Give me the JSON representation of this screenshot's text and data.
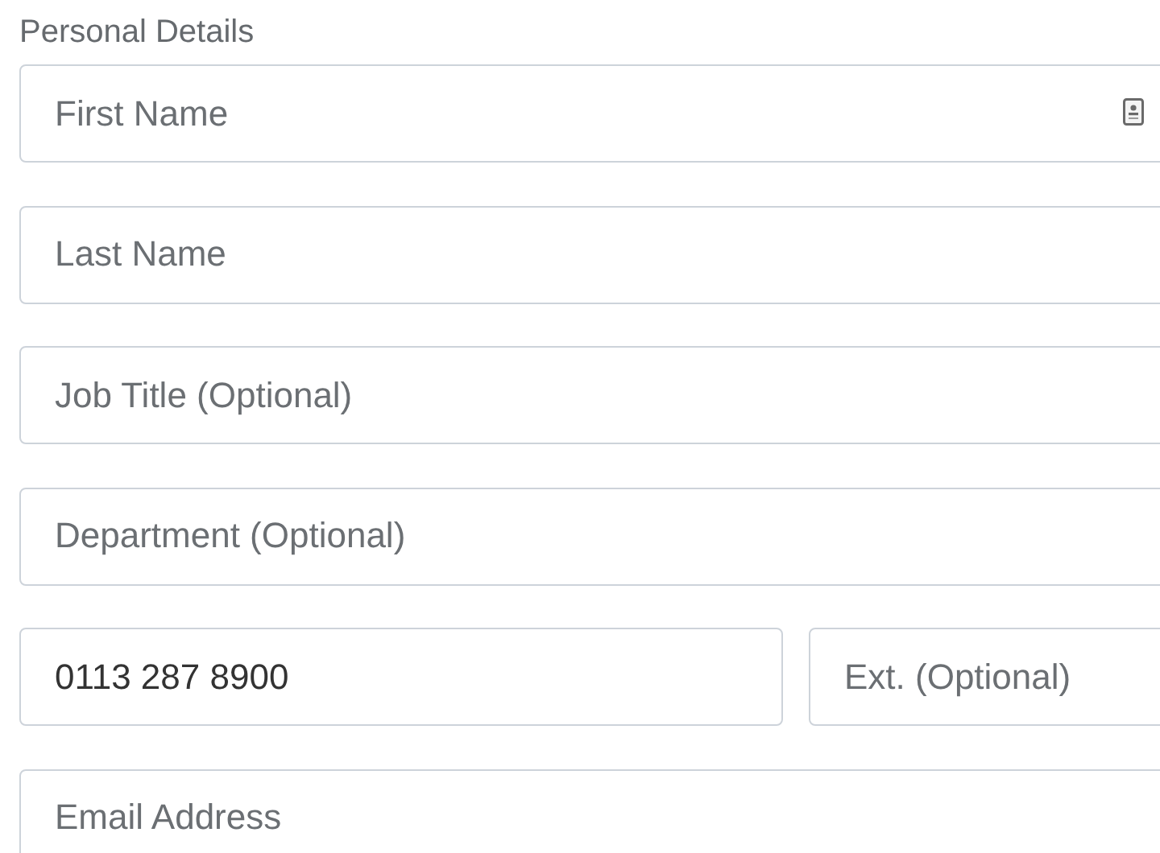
{
  "section_title": "Personal Details",
  "fields": [
    {
      "kind": "single",
      "inputs": [
        {
          "placeholder": "First Name",
          "autofill_icon": true
        }
      ]
    },
    {
      "kind": "single",
      "inputs": [
        {
          "placeholder": "Last Name"
        }
      ]
    },
    {
      "kind": "single",
      "inputs": [
        {
          "placeholder": "Job Title (Optional)"
        }
      ]
    },
    {
      "kind": "single",
      "inputs": [
        {
          "placeholder": "Department (Optional)"
        }
      ]
    },
    {
      "kind": "pair",
      "inputs": [
        {
          "value": "0113 287 8900"
        },
        {
          "placeholder": "Ext. (Optional)"
        }
      ]
    },
    {
      "kind": "single",
      "inputs": [
        {
          "placeholder": "Email Address"
        }
      ]
    }
  ]
}
